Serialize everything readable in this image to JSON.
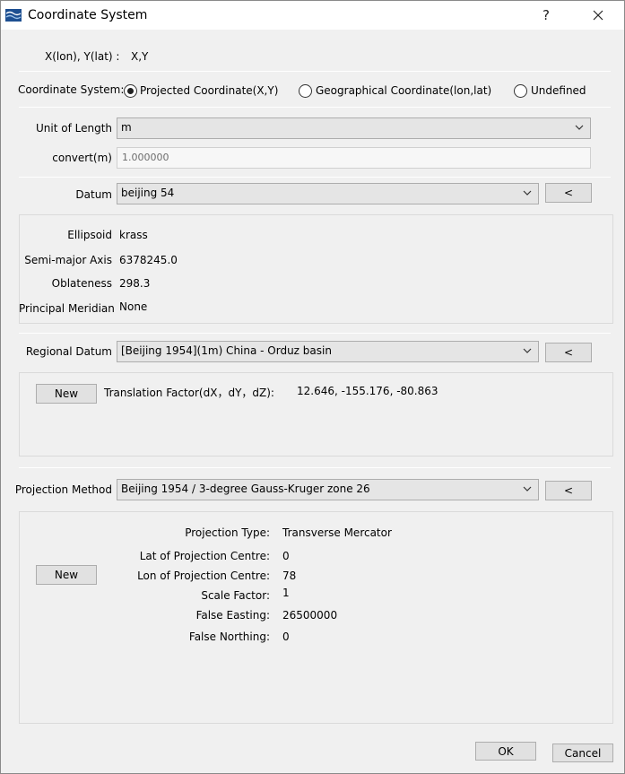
{
  "window": {
    "title": "Coordinate System",
    "help_glyph": "?",
    "close_glyph": "✕"
  },
  "coord_readout": {
    "label": "X(lon), Y(lat) :",
    "value": "X,Y"
  },
  "coordinate_system": {
    "label": "Coordinate System:",
    "options": [
      "Projected Coordinate(X,Y)",
      "Geographical Coordinate(lon,lat)",
      "Undefined"
    ],
    "selected_index": 0
  },
  "unit": {
    "label": "Unit of Length",
    "value": "m",
    "convert_label": "convert(m)",
    "convert_value": "1.000000"
  },
  "datum": {
    "label": "Datum",
    "value": "beijing 54",
    "button": "<",
    "ellipsoid_label": "Ellipsoid",
    "ellipsoid_value": "krass",
    "semi_major_label": "Semi-major Axis",
    "semi_major_value": "6378245.0",
    "oblateness_label": "Oblateness",
    "oblateness_value": "298.3",
    "meridian_label": "Principal Meridian",
    "meridian_value": "None"
  },
  "regional_datum": {
    "label": "Regional Datum",
    "value": "[Beijing 1954](1m) China - Orduz basin",
    "button": "<",
    "new_button": "New",
    "translation_label": "Translation Factor(dX，dY，dZ):",
    "translation_value": "12.646, -155.176, -80.863"
  },
  "projection": {
    "label": "Projection Method",
    "value": "Beijing 1954 / 3-degree Gauss-Kruger zone 26",
    "button": "<",
    "new_button": "New",
    "type_label": "Projection Type:",
    "type_value": "Transverse Mercator",
    "lat_label": "Lat of Projection Centre:",
    "lat_value": "0",
    "lon_label": "Lon of Projection Centre:",
    "lon_value": "78",
    "scale_label": "Scale Factor:",
    "scale_value": "1",
    "easting_label": "False Easting:",
    "easting_value": "26500000",
    "northing_label": "False Northing:",
    "northing_value": "0"
  },
  "footer": {
    "ok": "OK",
    "cancel": "Cancel"
  },
  "colors": {
    "title_bg": "#ffffff",
    "dialog_bg": "#f0f0f0",
    "button_bg": "#e1e1e1",
    "combo_bg": "#e5e5e5"
  }
}
